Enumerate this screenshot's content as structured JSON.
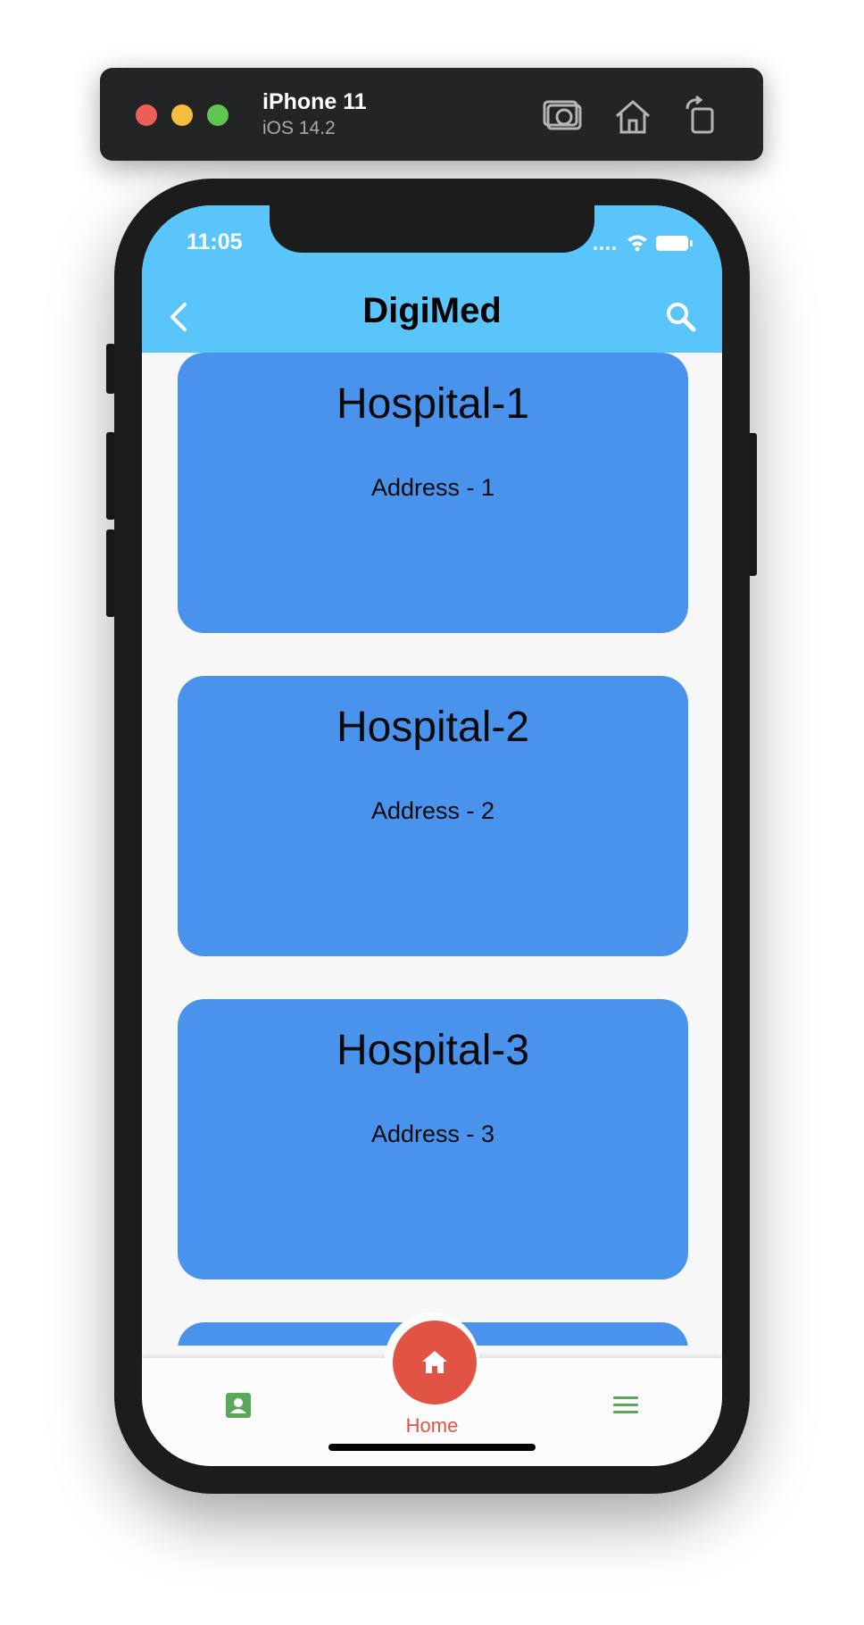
{
  "simulator": {
    "device_name": "iPhone 11",
    "os_version": "iOS 14.2",
    "tools": [
      "screenshot-icon",
      "home-icon",
      "rotate-icon"
    ]
  },
  "status_bar": {
    "time": "11:05"
  },
  "app_bar": {
    "title": "DigiMed",
    "back_icon": "chevron-left-icon",
    "search_icon": "search-icon"
  },
  "hospitals": [
    {
      "name": "Hospital-1",
      "address": "Address - 1"
    },
    {
      "name": "Hospital-2",
      "address": "Address - 2"
    },
    {
      "name": "Hospital-3",
      "address": "Address - 3"
    },
    {
      "name": "",
      "address": ""
    }
  ],
  "bottom_nav": {
    "left_icon": "contact-card-icon",
    "center_icon": "home-icon",
    "center_label": "Home",
    "right_icon": "menu-icon"
  },
  "colors": {
    "app_bar": "#5ac5fa",
    "card": "#4a93ec",
    "fab": "#e15444",
    "nav_icon": "#5aa95a"
  }
}
